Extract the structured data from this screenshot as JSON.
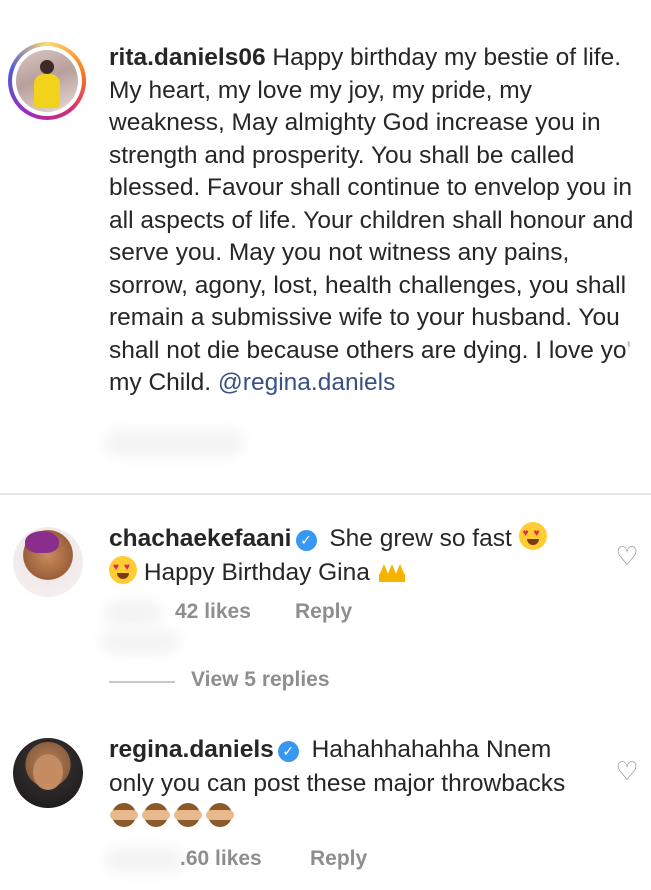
{
  "caption": {
    "username": "rita.daniels06",
    "text": "Happy birthday my bestie of life. My heart, my love my joy, my pride, my weakness,  May almighty God increase you in strength and prosperity. You shall be called blessed. Favour shall continue to envelop you in all aspects of life. Your children shall honour and serve you. May you not witness any pains, sorrow, agony, lost, health challenges, you shall remain a submissive wife to your husband. You shall not die because others are dying. I love yo",
    "text_tail": " my Child.",
    "obscured_fragment": "'",
    "mention": "@regina.daniels"
  },
  "comments": [
    {
      "username": "chachaekefaani",
      "verified": true,
      "text_part1": "She grew so fast",
      "text_part2": "Happy Birthday Gina",
      "likes": "42 likes",
      "reply_label": "Reply",
      "view_replies": "View 5 replies",
      "icons": [
        "heart-eyes-emoji",
        "heart-eyes-emoji",
        "crown-emoji"
      ]
    },
    {
      "username": "regina.daniels",
      "verified": true,
      "text": "Hahahhahahha Nnem only you can post these major throwbacks",
      "likes": "60 likes",
      "likes_visible": ".60 likes",
      "reply_label": "Reply",
      "icons": [
        "see-no-evil-monkey-emoji",
        "see-no-evil-monkey-emoji",
        "see-no-evil-monkey-emoji",
        "see-no-evil-monkey-emoji"
      ]
    }
  ],
  "colors": {
    "text": "#262626",
    "muted": "#8e8e8e",
    "mention": "#385185",
    "verified": "#3897f0"
  }
}
